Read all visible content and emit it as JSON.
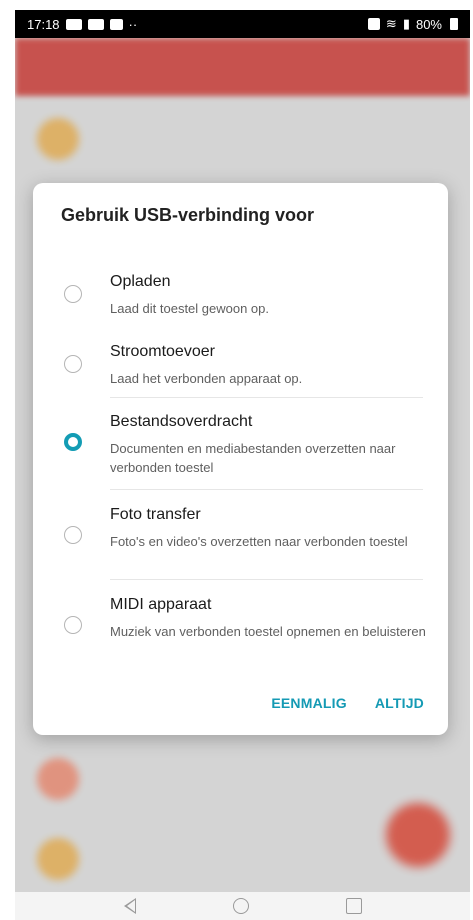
{
  "status_bar": {
    "time": "17:18",
    "battery": "80%",
    "icons_left": [
      "video-icon",
      "news-icon",
      "mail-icon",
      "more-icon"
    ],
    "icons_right": [
      "nfc-icon",
      "wifi-icon",
      "signal-icon",
      "battery-icon"
    ]
  },
  "dialog": {
    "title": "Gebruik USB-verbinding voor",
    "options": [
      {
        "title": "Opladen",
        "description": "Laad dit toestel gewoon op.",
        "selected": false
      },
      {
        "title": "Stroomtoevoer",
        "description": "Laad het verbonden apparaat op.",
        "selected": false
      },
      {
        "title": "Bestandsoverdracht",
        "description": "Documenten en mediabestanden overzetten naar verbonden toestel",
        "selected": true
      },
      {
        "title": "Foto transfer",
        "description": "Foto's en video's overzetten naar verbonden toestel",
        "selected": false
      },
      {
        "title": "MIDI apparaat",
        "description": "Muziek van verbonden toestel opnemen en beluisteren",
        "selected": false
      }
    ],
    "buttons": {
      "once": "EENMALIG",
      "always": "ALTIJD"
    }
  },
  "nav_bar": {
    "icons": [
      "back-icon",
      "home-icon",
      "recents-icon"
    ]
  },
  "colors": {
    "accent": "#139cb4",
    "background_header": "#d85a55"
  }
}
